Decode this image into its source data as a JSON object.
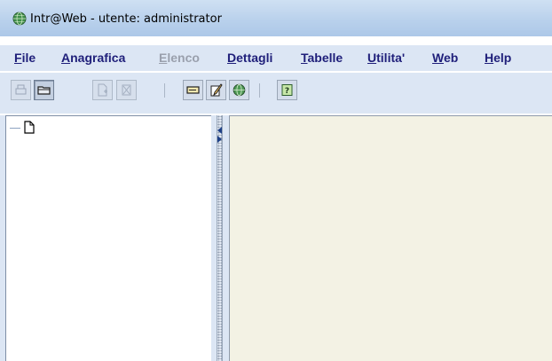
{
  "window": {
    "title": "Intr@Web - utente: administrator",
    "app_icon": "globe-icon"
  },
  "menu": [
    {
      "label": "File",
      "mnemonic": "F",
      "rest": "ile",
      "enabled": true
    },
    {
      "label": "Anagrafica",
      "mnemonic": "A",
      "rest": "nagrafica",
      "enabled": true
    },
    {
      "label": "Elenco",
      "mnemonic": "E",
      "rest": "lenco",
      "enabled": false
    },
    {
      "label": "Dettagli",
      "mnemonic": "D",
      "rest": "ettagli",
      "enabled": true
    },
    {
      "label": "Tabelle",
      "mnemonic": "T",
      "rest": "abelle",
      "enabled": true
    },
    {
      "label": "Utilita'",
      "mnemonic": "U",
      "rest": "tilita'",
      "enabled": true
    },
    {
      "label": "Web",
      "mnemonic": "W",
      "rest": "eb",
      "enabled": true
    },
    {
      "label": "Help",
      "mnemonic": "H",
      "rest": "elp",
      "enabled": true
    }
  ],
  "toolbar": {
    "buttons": [
      {
        "icon": "print-icon",
        "enabled": false
      },
      {
        "icon": "open-folder-icon",
        "enabled": true,
        "pressed": true
      },
      {
        "icon": "new-document-icon",
        "enabled": false
      },
      {
        "icon": "delete-icon",
        "enabled": false
      },
      {
        "icon": "card-icon",
        "enabled": true
      },
      {
        "icon": "edit-pencil-icon",
        "enabled": true
      },
      {
        "icon": "globe-icon",
        "enabled": true
      },
      {
        "icon": "help-icon",
        "enabled": true
      }
    ]
  },
  "tree": {
    "root_icon": "document-icon"
  },
  "colors": {
    "titlebar": "#b9d1ec",
    "menubar": "#dce6f4",
    "menu_text": "#1f1f7a",
    "menu_disabled": "#9aa0ad",
    "tree_bg": "#ffffff",
    "content_bg": "#f3f2e4"
  }
}
